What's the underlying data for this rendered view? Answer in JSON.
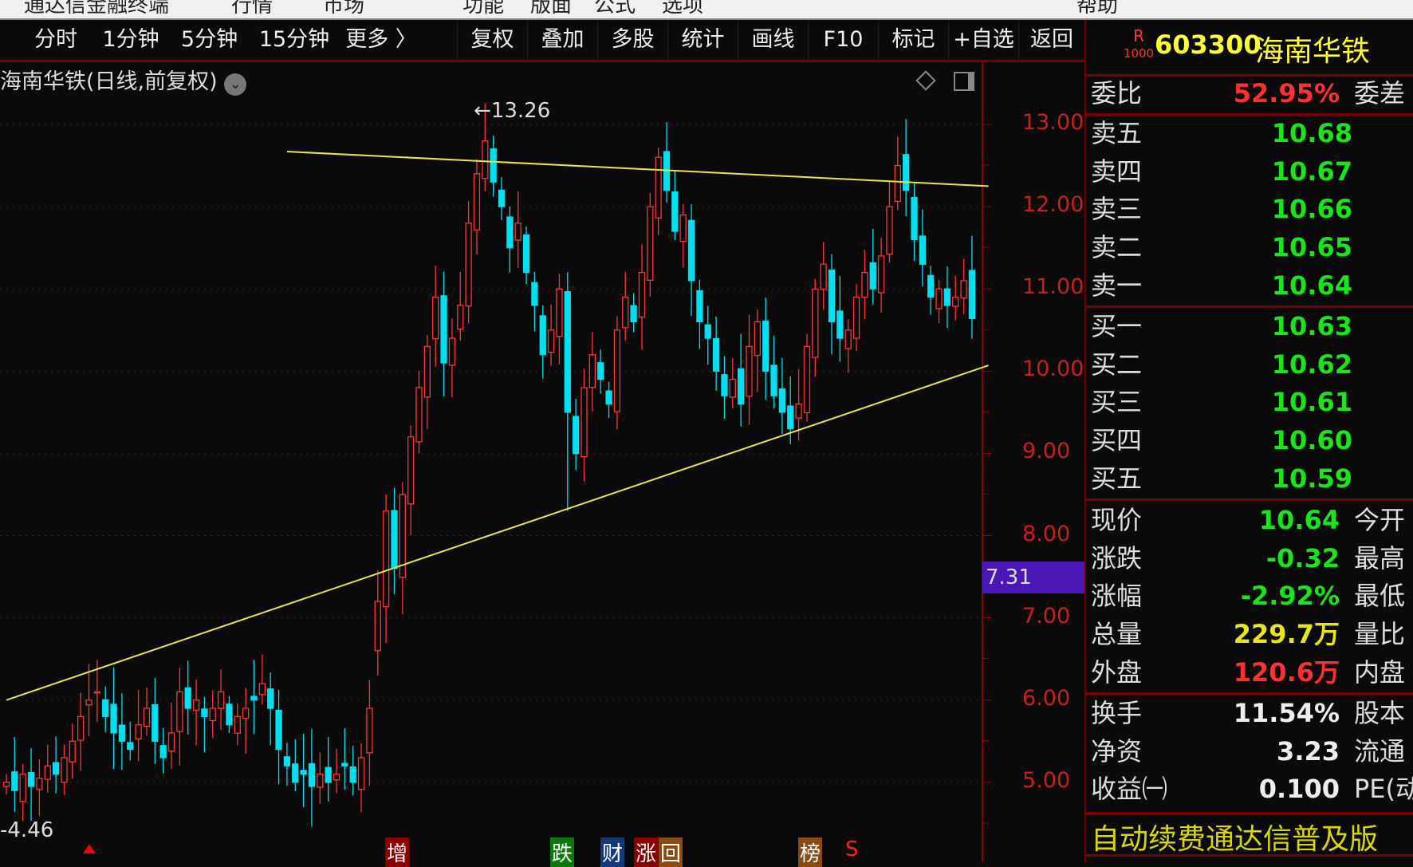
{
  "menubar": {
    "items": [
      "通达信金融终端",
      "行情",
      "市场",
      "功能",
      "版面",
      "公式",
      "选项",
      "帮助"
    ]
  },
  "toolbar": {
    "items": [
      "分时",
      "1分钟",
      "5分钟",
      "15分钟",
      "更多 〉",
      "复权",
      "叠加",
      "多股",
      "统计",
      "画线",
      "F10",
      "标记",
      "+自选",
      "返回"
    ]
  },
  "chart": {
    "title": "海南华铁(日线,前复权)",
    "high_label": "13.26",
    "low_label": "4.46",
    "current_marker": "7.31",
    "markers": [
      "增",
      "跌",
      "财",
      "涨",
      "回",
      "榜",
      "S"
    ]
  },
  "right": {
    "badge_top": "R",
    "badge_bottom": "1000",
    "code": "603300",
    "name": "海南华铁",
    "weibi": {
      "label": "委比",
      "value": "52.95%",
      "right": "委差"
    },
    "sell": [
      {
        "label": "卖五",
        "price": "10.68"
      },
      {
        "label": "卖四",
        "price": "10.67"
      },
      {
        "label": "卖三",
        "price": "10.66"
      },
      {
        "label": "卖二",
        "price": "10.65"
      },
      {
        "label": "卖一",
        "price": "10.64"
      }
    ],
    "buy": [
      {
        "label": "买一",
        "price": "10.63"
      },
      {
        "label": "买二",
        "price": "10.62"
      },
      {
        "label": "买三",
        "price": "10.61"
      },
      {
        "label": "买四",
        "price": "10.60"
      },
      {
        "label": "买五",
        "price": "10.59"
      }
    ],
    "stats": [
      {
        "label": "现价",
        "value": "10.64",
        "right": "今开",
        "color": "#19e619"
      },
      {
        "label": "涨跌",
        "value": "-0.32",
        "right": "最高",
        "color": "#19e619"
      },
      {
        "label": "涨幅",
        "value": "-2.92%",
        "right": "最低",
        "color": "#19e619"
      },
      {
        "label": "总量",
        "value": "229.7万",
        "right": "量比",
        "color": "#e6e619"
      },
      {
        "label": "外盘",
        "value": "120.6万",
        "right": "内盘",
        "color": "#ff3030"
      }
    ],
    "stats2": [
      {
        "label": "换手",
        "value": "11.54%",
        "right": "股本"
      },
      {
        "label": "净资",
        "value": "3.23",
        "right": "流通"
      },
      {
        "label": "收益㈠",
        "value": "0.100",
        "right": "PE(动"
      }
    ],
    "promo": "自动续费通达信普及版"
  },
  "chart_data": {
    "type": "candlestick",
    "y_ticks": [
      "13.00",
      "12.00",
      "11.00",
      "10.00",
      "9.00",
      "8.00",
      "7.00",
      "6.00",
      "5.00"
    ],
    "ylim": [
      4.3,
      13.5
    ],
    "closes": [
      5.0,
      4.9,
      5.1,
      4.95,
      5.05,
      5.2,
      5.1,
      5.3,
      5.5,
      5.8,
      6.0,
      6.1,
      5.8,
      5.6,
      5.5,
      5.4,
      5.7,
      5.9,
      5.5,
      5.3,
      5.6,
      6.1,
      5.9,
      6.0,
      5.8,
      5.9,
      6.1,
      5.7,
      5.8,
      5.9,
      6.0,
      6.2,
      5.9,
      5.4,
      5.2,
      5.0,
      5.1,
      4.95,
      5.1,
      5.0,
      5.1,
      5.2,
      5.0,
      5.3,
      5.9,
      7.2,
      8.3,
      7.6,
      8.5,
      9.2,
      9.8,
      10.3,
      10.9,
      10.1,
      10.4,
      10.8,
      11.8,
      12.4,
      12.8,
      12.3,
      12.0,
      11.5,
      11.8,
      11.2,
      10.8,
      10.2,
      10.5,
      11.0,
      9.5,
      9.0,
      9.8,
      10.2,
      9.9,
      9.6,
      10.5,
      10.9,
      10.6,
      11.2,
      12.0,
      12.6,
      12.2,
      11.7,
      11.9,
      11.1,
      10.6,
      10.4,
      10.0,
      9.7,
      9.9,
      9.6,
      10.3,
      10.6,
      10.0,
      9.7,
      9.5,
      9.3,
      9.6,
      10.3,
      11.0,
      11.3,
      10.6,
      10.4,
      10.5,
      10.9,
      11.2,
      11.0,
      11.4,
      12.0,
      12.5,
      12.2,
      11.6,
      11.3,
      10.9,
      11.0,
      10.8,
      10.9,
      11.1,
      10.64
    ],
    "trendlines": [
      {
        "from": [
          34,
          12.67
        ],
        "to": [
          119,
          12.25
        ]
      },
      {
        "from": [
          0,
          6.0
        ],
        "to": [
          119,
          10.07
        ]
      }
    ]
  }
}
